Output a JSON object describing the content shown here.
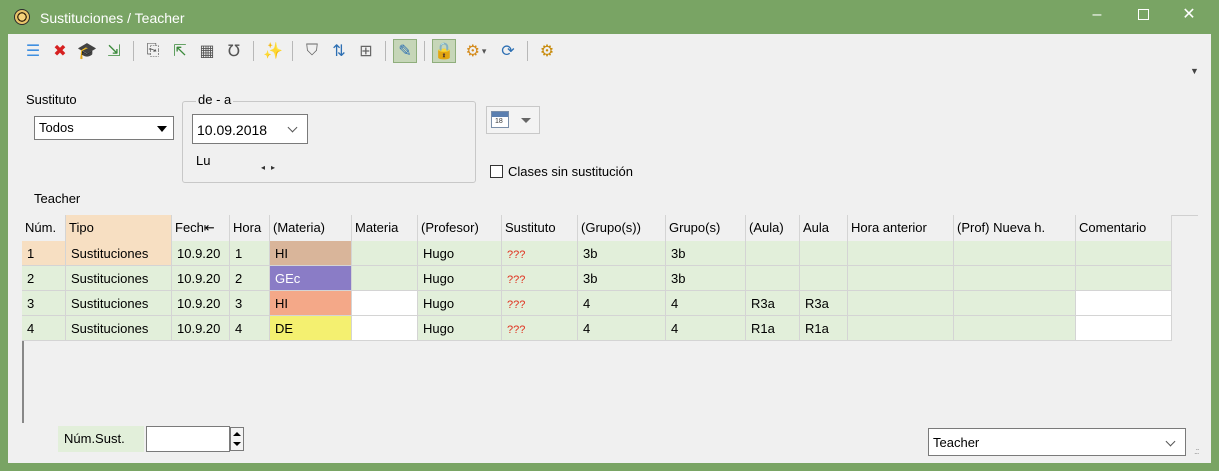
{
  "window": {
    "title": "Sustituciones / Teacher",
    "minimize_glyph": "‒",
    "close_glyph": "✕",
    "accent_color": "#79a464"
  },
  "toolbar": {
    "icons": [
      {
        "name": "list-icon",
        "glyph": "☰",
        "color": "#3f8fe0"
      },
      {
        "name": "delete-icon",
        "glyph": "✖",
        "color": "#d62020"
      },
      {
        "name": "teacher-hat-icon",
        "glyph": "🎓",
        "color": "#333"
      },
      {
        "name": "export-icon",
        "glyph": "⇲",
        "color": "#3b8a3b"
      },
      "sep",
      {
        "name": "copy-icon",
        "glyph": "⎘",
        "color": "#555"
      },
      {
        "name": "import-icon",
        "glyph": "⇱",
        "color": "#3b8a3b"
      },
      {
        "name": "calculator-icon",
        "glyph": "▦",
        "color": "#555"
      },
      {
        "name": "stethoscope-icon",
        "glyph": "℧",
        "color": "#555"
      },
      "sep",
      {
        "name": "magic-wand-icon",
        "glyph": "✨",
        "color": "#777"
      },
      "sep",
      {
        "name": "filter-icon",
        "glyph": "⛉",
        "color": "#666"
      },
      {
        "name": "sort-icon",
        "glyph": "⇅",
        "color": "#2d6fb3"
      },
      {
        "name": "table-icon",
        "glyph": "⊞",
        "color": "#666"
      },
      "sep",
      {
        "name": "pencil-icon",
        "glyph": "✎",
        "color": "#2d6fb3",
        "active": true
      },
      "sep",
      {
        "name": "lock-icon",
        "glyph": "🔒",
        "color": "#b08c1a",
        "active": true
      },
      {
        "name": "document-gear-icon",
        "glyph": "⚙",
        "color": "#d48a1a",
        "dropdown": true
      },
      {
        "name": "refresh-icon",
        "glyph": "⟳",
        "color": "#2d6fb3"
      },
      "sep",
      {
        "name": "settings-gear-icon",
        "glyph": "⚙",
        "color": "#c78a0a"
      }
    ],
    "overflow_glyph": "▼"
  },
  "filters": {
    "sustituto_label": "Sustituto",
    "sustituto_value": "Todos",
    "range_label": "de - a",
    "date_value": "10.09.2018",
    "day_label": "Lu",
    "nav_prev": "◂",
    "nav_next": "▸",
    "calendar_day": "18",
    "checkbox_label": "Clases sin sustitución",
    "checkbox_checked": false
  },
  "section_label": "Teacher",
  "table": {
    "columns": [
      "Núm.",
      "Tipo",
      "Fech⇤",
      "Hora",
      "(Materia)",
      "Materia",
      "(Profesor)",
      "Sustituto",
      "(Grupo(s))",
      "Grupo(s)",
      "(Aula)",
      "Aula",
      "Hora anterior",
      "(Prof) Nueva h.",
      "Comentario"
    ],
    "sorted_column": 1,
    "rows": [
      {
        "num": "1",
        "tipo": "Sustituciones",
        "fecha": "10.9.20",
        "hora": "1",
        "materia_orig": "HI",
        "materia": "",
        "profesor": "Hugo",
        "sustituto": "???",
        "grupos_orig": "3b",
        "grupos": "3b",
        "aula_orig": "",
        "aula": "",
        "hora_anterior": "",
        "nueva_h": "",
        "comentario": "",
        "subject_color": "#d9b59a",
        "row_color": "#f7dfc2"
      },
      {
        "num": "2",
        "tipo": "Sustituciones",
        "fecha": "10.9.20",
        "hora": "2",
        "materia_orig": "GEc",
        "materia": "",
        "profesor": "Hugo",
        "sustituto": "???",
        "grupos_orig": "3b",
        "grupos": "3b",
        "aula_orig": "",
        "aula": "",
        "hora_anterior": "",
        "nueva_h": "",
        "comentario": "",
        "subject_color": "#8a7cc6",
        "row_color": "#ffffff"
      },
      {
        "num": "3",
        "tipo": "Sustituciones",
        "fecha": "10.9.20",
        "hora": "3",
        "materia_orig": "HI",
        "materia": "",
        "profesor": "Hugo",
        "sustituto": "???",
        "grupos_orig": "4",
        "grupos": "4",
        "aula_orig": "R3a",
        "aula": "R3a",
        "hora_anterior": "",
        "nueva_h": "",
        "comentario": "",
        "subject_color": "#f4a888",
        "row_color": "#ffffff"
      },
      {
        "num": "4",
        "tipo": "Sustituciones",
        "fecha": "10.9.20",
        "hora": "4",
        "materia_orig": "DE",
        "materia": "",
        "profesor": "Hugo",
        "sustituto": "???",
        "grupos_orig": "4",
        "grupos": "4",
        "aula_orig": "R1a",
        "aula": "R1a",
        "hora_anterior": "",
        "nueva_h": "",
        "comentario": "",
        "subject_color": "#f4f070",
        "row_color": "#ffffff"
      }
    ],
    "readonly_cell_color": "#e2efda"
  },
  "footer": {
    "num_sust_label": "Núm.Sust.",
    "num_sust_value": "",
    "view_value": "Teacher"
  }
}
